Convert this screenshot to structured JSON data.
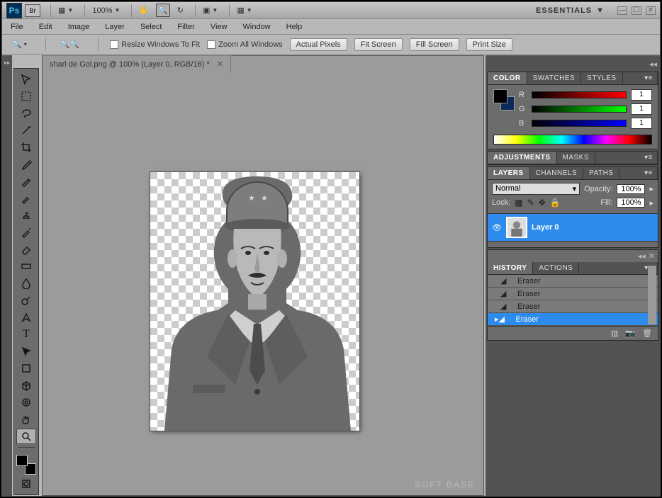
{
  "top": {
    "ps": "Ps",
    "br": "Br",
    "zoom": "100%",
    "workspace": "ESSENTIALS"
  },
  "menu": {
    "file": "File",
    "edit": "Edit",
    "image": "Image",
    "layer": "Layer",
    "select": "Select",
    "filter": "Filter",
    "view": "View",
    "window": "Window",
    "help": "Help"
  },
  "options": {
    "resize": "Resize Windows To Fit",
    "zoom_all": "Zoom All Windows",
    "actual": "Actual Pixels",
    "fit": "Fit Screen",
    "fill": "Fill Screen",
    "print": "Print Size"
  },
  "document": {
    "tab": "sharl de Gol.png @ 100% (Layer 0, RGB/16) *"
  },
  "panels": {
    "color": {
      "tab": "COLOR",
      "swatches": "SWATCHES",
      "styles": "STYLES",
      "r_label": "R",
      "g_label": "G",
      "b_label": "B",
      "r": "1",
      "g": "1",
      "b": "1"
    },
    "adjustments": {
      "tab": "ADJUSTMENTS",
      "masks": "MASKS"
    },
    "layers": {
      "tab": "LAYERS",
      "channels": "CHANNELS",
      "paths": "PATHS",
      "blend": "Normal",
      "opacity_lbl": "Opacity:",
      "opacity": "100%",
      "lock_lbl": "Lock:",
      "fill_lbl": "Fill:",
      "fill": "100%",
      "layer0": "Layer 0"
    },
    "history": {
      "tab": "HISTORY",
      "actions": "ACTIONS",
      "items": [
        "Eraser",
        "Eraser",
        "Eraser",
        "Eraser"
      ]
    }
  },
  "watermark": "SOFT  BASE"
}
